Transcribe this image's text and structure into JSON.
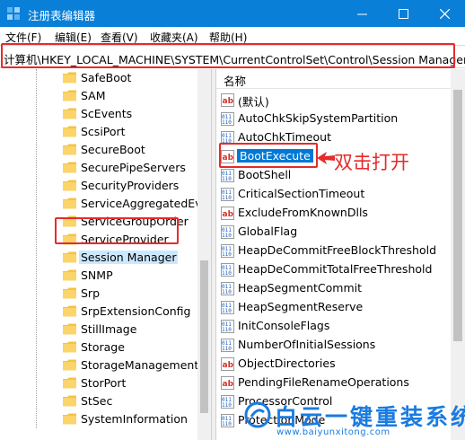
{
  "window": {
    "title": "注册表编辑器",
    "controls": [
      "minimize",
      "maximize",
      "close"
    ]
  },
  "menu": [
    "文件(F)",
    "编辑(E)",
    "查看(V)",
    "收藏夹(A)",
    "帮助(H)"
  ],
  "address": "计算机\\HKEY_LOCAL_MACHINE\\SYSTEM\\CurrentControlSet\\Control\\Session Manager",
  "tree": {
    "items": [
      "SafeBoot",
      "SAM",
      "ScEvents",
      "ScsiPort",
      "SecureBoot",
      "SecurePipeServers",
      "SecurityProviders",
      "ServiceAggregatedEve",
      "ServiceGroupOrder",
      "ServiceProvider",
      "Session Manager",
      "SNMP",
      "Srp",
      "SrpExtensionConfig",
      "StillImage",
      "Storage",
      "StorageManagement",
      "StorPort",
      "StSec",
      "SystemInformation"
    ],
    "selected": "Session Manager"
  },
  "values": {
    "column_name": "名称",
    "items": [
      {
        "name": "(默认)",
        "type": "string"
      },
      {
        "name": "AutoChkSkipSystemPartition",
        "type": "binary"
      },
      {
        "name": "AutoChkTimeout",
        "type": "binary"
      },
      {
        "name": "BootExecute",
        "type": "string"
      },
      {
        "name": "BootShell",
        "type": "binary"
      },
      {
        "name": "CriticalSectionTimeout",
        "type": "binary"
      },
      {
        "name": "ExcludeFromKnownDlls",
        "type": "string"
      },
      {
        "name": "GlobalFlag",
        "type": "binary"
      },
      {
        "name": "HeapDeCommitFreeBlockThreshold",
        "type": "binary"
      },
      {
        "name": "HeapDeCommitTotalFreeThreshold",
        "type": "binary"
      },
      {
        "name": "HeapSegmentCommit",
        "type": "binary"
      },
      {
        "name": "HeapSegmentReserve",
        "type": "binary"
      },
      {
        "name": "InitConsoleFlags",
        "type": "binary"
      },
      {
        "name": "NumberOfInitialSessions",
        "type": "binary"
      },
      {
        "name": "ObjectDirectories",
        "type": "string"
      },
      {
        "name": "PendingFileRenameOperations",
        "type": "string"
      },
      {
        "name": "ProcessorControl",
        "type": "binary"
      },
      {
        "name": "ProtectionMode",
        "type": "binary"
      }
    ],
    "selected": "BootExecute"
  },
  "annotation": "双击打开",
  "watermark": {
    "title": "白云一键重装系统",
    "url": "www.baiyunxitong.com"
  },
  "colors": {
    "titlebar": "#0a7fd8",
    "highlight": "#e52b2b",
    "selection": "#0078d7",
    "folder": "#f5c342",
    "watermark": "#1a7be0"
  }
}
